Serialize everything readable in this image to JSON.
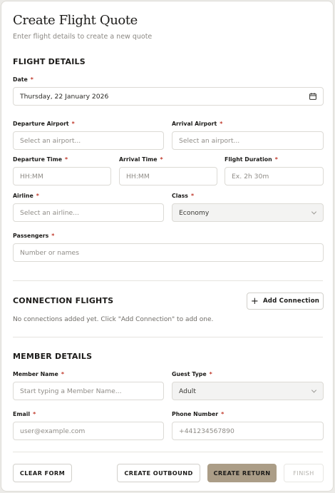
{
  "header": {
    "title": "Create Flight Quote",
    "subtitle": "Enter flight details to create a new quote"
  },
  "flight_details": {
    "section_title": "FLIGHT DETAILS",
    "date_label": "Date",
    "date_value": "Thursday, 22 January 2026",
    "departure_airport_label": "Departure Airport",
    "departure_airport_placeholder": "Select an airport...",
    "arrival_airport_label": "Arrival Airport",
    "arrival_airport_placeholder": "Select an airport...",
    "departure_time_label": "Departure Time",
    "departure_time_placeholder": "HH:MM",
    "arrival_time_label": "Arrival Time",
    "arrival_time_placeholder": "HH:MM",
    "flight_duration_label": "Flight Duration",
    "flight_duration_placeholder": "Ex. 2h 30m",
    "airline_label": "Airline",
    "airline_placeholder": "Select an airline...",
    "class_label": "Class",
    "class_value": "Economy",
    "passengers_label": "Passengers",
    "passengers_placeholder": "Number or names"
  },
  "connection_flights": {
    "section_title": "CONNECTION FLIGHTS",
    "add_button_label": "Add Connection",
    "empty_message": "No connections added yet. Click \"Add Connection\" to add one."
  },
  "member_details": {
    "section_title": "MEMBER DETAILS",
    "member_name_label": "Member Name",
    "member_name_placeholder": "Start typing a Member Name...",
    "guest_type_label": "Guest Type",
    "guest_type_value": "Adult",
    "email_label": "Email",
    "email_placeholder": "user@example.com",
    "phone_label": "Phone Number",
    "phone_placeholder": "+441234567890"
  },
  "footer": {
    "clear_label": "CLEAR FORM",
    "outbound_label": "CREATE OUTBOUND",
    "return_label": "CREATE RETURN",
    "finish_label": "FINISH"
  },
  "required_marker": "*",
  "colors": {
    "accent": "#ab9d87",
    "required": "#c0392b",
    "border": "#dcdad5"
  },
  "icons": {
    "date_field": "calendar-icon",
    "select_field": "chevron-down-icon",
    "add_connection": "plus-icon"
  }
}
